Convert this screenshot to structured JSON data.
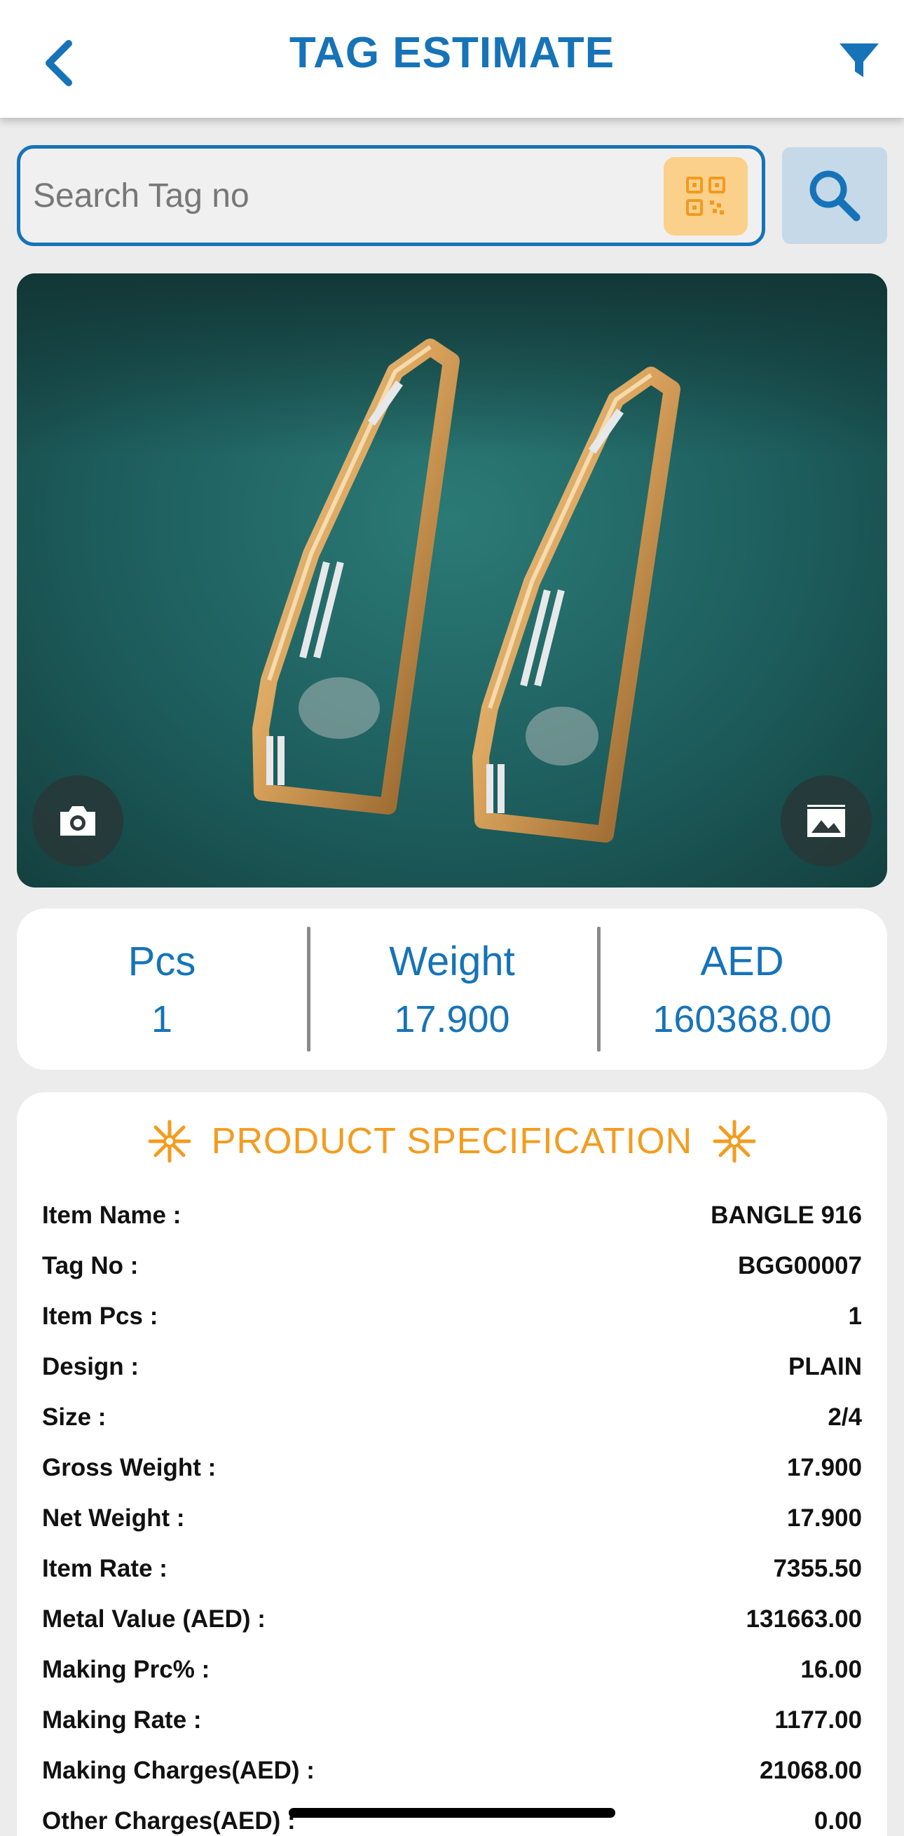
{
  "header": {
    "title": "TAG ESTIMATE",
    "back_icon": "chevron-left-icon",
    "filter_icon": "filter-icon"
  },
  "search": {
    "placeholder": "Search Tag no",
    "value": "",
    "qr_icon": "qr-code-icon",
    "search_icon": "search-icon"
  },
  "photo": {
    "subject": "bangles",
    "camera_icon": "camera-icon",
    "gallery_icon": "image-icon"
  },
  "summary": [
    {
      "label": "Pcs",
      "value": "1"
    },
    {
      "label": "Weight",
      "value": "17.900"
    },
    {
      "label": "AED",
      "value": "160368.00"
    }
  ],
  "spec": {
    "title": "PRODUCT SPECIFICATION",
    "rows": [
      {
        "label": "Item Name :",
        "value": "BANGLE 916"
      },
      {
        "label": "Tag No :",
        "value": "BGG00007"
      },
      {
        "label": "Item Pcs :",
        "value": "1"
      },
      {
        "label": "Design :",
        "value": "PLAIN"
      },
      {
        "label": "Size :",
        "value": "2/4"
      },
      {
        "label": "Gross Weight :",
        "value": "17.900"
      },
      {
        "label": "Net Weight :",
        "value": "17.900"
      },
      {
        "label": "Item Rate :",
        "value": "7355.50"
      },
      {
        "label": "Metal Value (AED) :",
        "value": "131663.00"
      },
      {
        "label": "Making Prc% :",
        "value": "16.00"
      },
      {
        "label": "Making Rate :",
        "value": "1177.00"
      },
      {
        "label": "Making Charges(AED) :",
        "value": "21068.00"
      },
      {
        "label": "Other Charges(AED) :",
        "value": "0.00"
      }
    ]
  },
  "colors": {
    "primary": "#1673b8",
    "accent": "#f39c1f",
    "qr_bg": "#fbd08a",
    "search_btn_bg": "#c5d9e8",
    "background": "#ececec"
  }
}
